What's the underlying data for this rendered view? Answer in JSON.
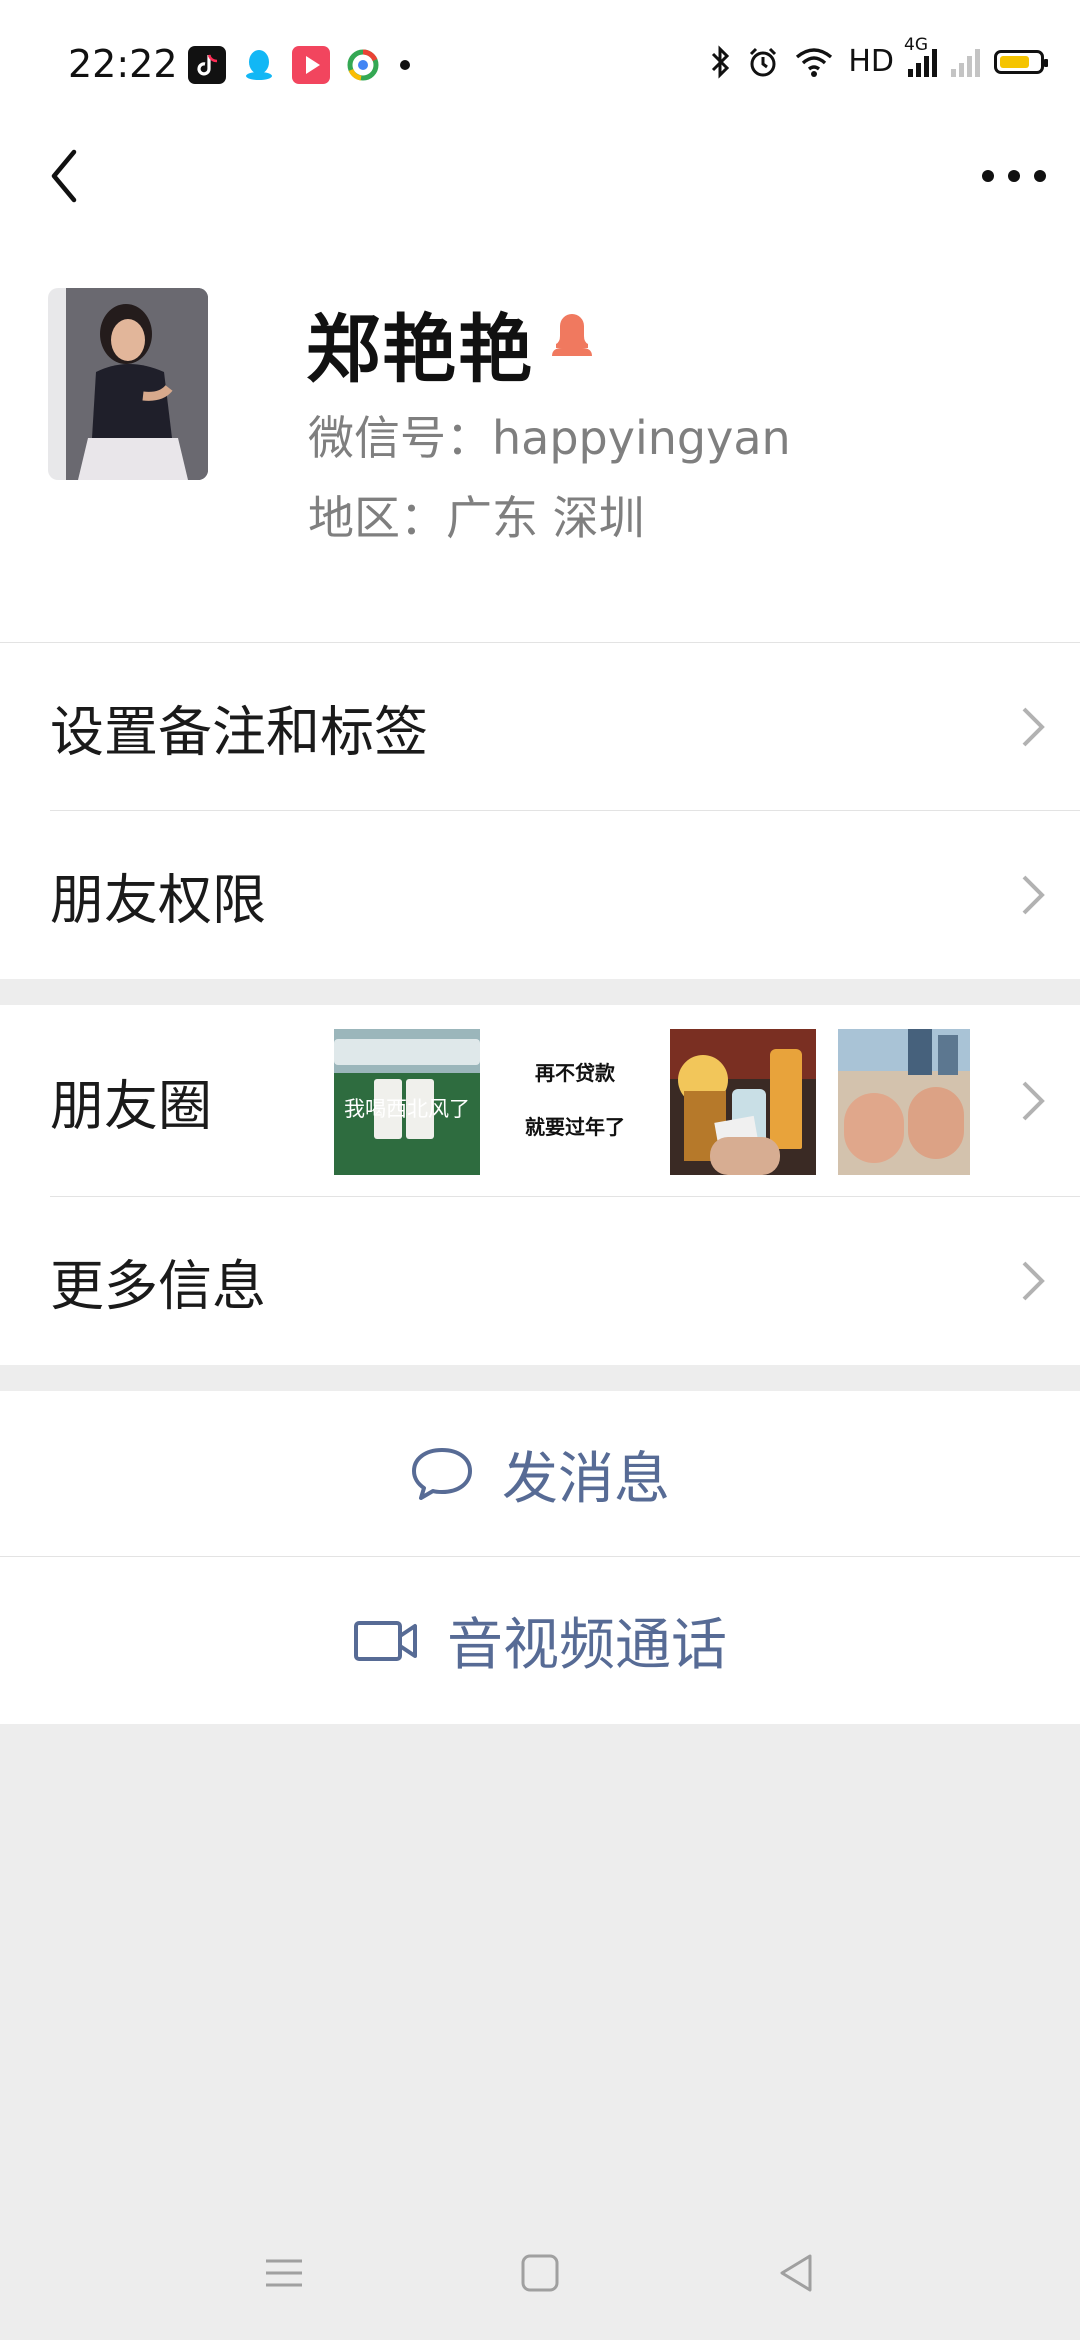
{
  "status_bar": {
    "time": "22:22",
    "hd_label": "HD",
    "network_label": "4G",
    "battery_level": 0.75,
    "apps": [
      "tiktok-icon",
      "qq-icon",
      "video-app-icon",
      "browser-icon"
    ]
  },
  "header": {
    "back_icon": "chevron-left-icon",
    "more_icon": "more-dots-icon"
  },
  "profile": {
    "name": "郑艳艳",
    "gender_icon": "female-icon",
    "wechat_id": "微信号：happyingyan",
    "region": "地区：广东  深圳"
  },
  "menu": {
    "remark": "设置备注和标签",
    "permissions": "朋友权限",
    "moments": "朋友圈",
    "more_info": "更多信息"
  },
  "moments_thumbs": [
    {
      "caption": "我喝西北风了",
      "tiles": [
        "西",
        "北"
      ]
    },
    {
      "caption_line1": "再不贷款",
      "caption_line2": "就要过年了"
    },
    {
      "caption": ""
    },
    {
      "caption": ""
    }
  ],
  "actions": {
    "message": "发消息",
    "call": "音视频通话"
  },
  "colors": {
    "link": "#576b95",
    "background": "#ededed",
    "female": "#f0795f"
  }
}
